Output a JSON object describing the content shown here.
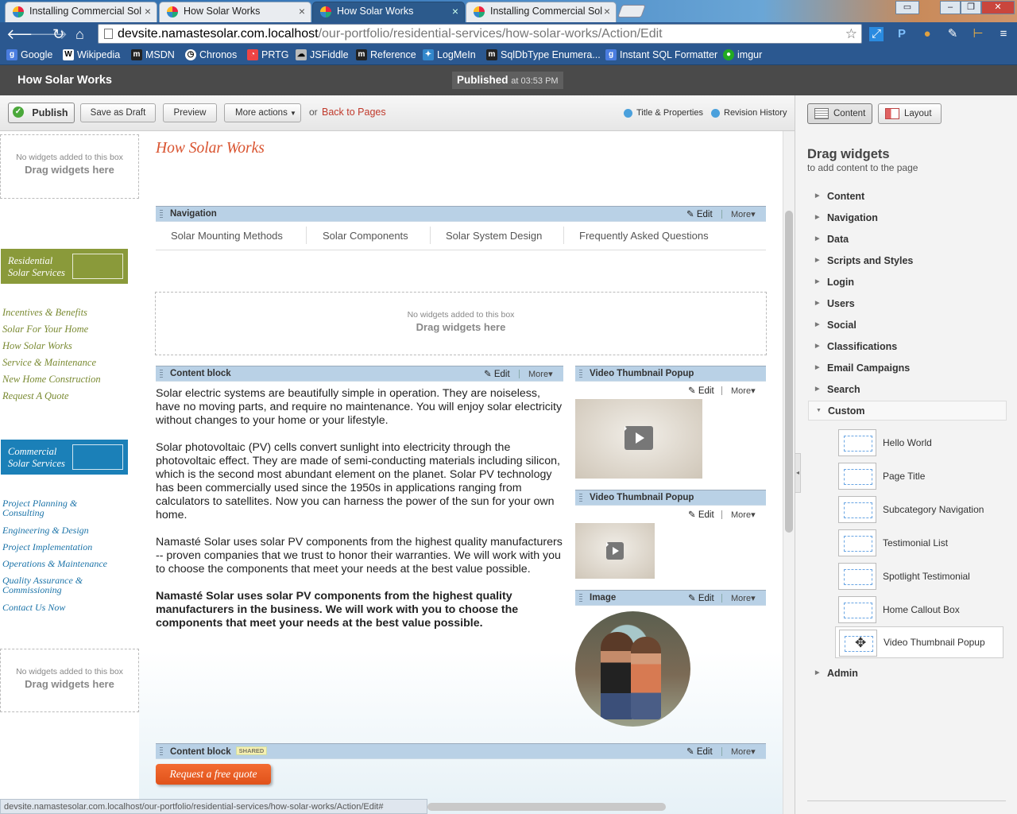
{
  "browser": {
    "tabs": [
      {
        "label": "Installing Commercial Sol"
      },
      {
        "label": "How Solar Works"
      },
      {
        "label": "How Solar Works"
      },
      {
        "label": "Installing Commercial Sol"
      }
    ],
    "url_host": "devsite.namastesolar.com.localhost",
    "url_path": "/our-portfolio/residential-services/how-solar-works/Action/Edit",
    "bookmarks": [
      "Google",
      "Wikipedia",
      "MSDN",
      "Chronos",
      "PRTG",
      "JSFiddle",
      "Reference",
      "LogMeIn",
      "SqlDbType Enumera...",
      "Instant SQL Formatter",
      "imgur"
    ],
    "status_url": "devsite.namastesolar.com.localhost/our-portfolio/residential-services/how-solar-works/Action/Edit#"
  },
  "cms": {
    "page_name": "How Solar Works",
    "published_label": "Published",
    "published_time": "at 03:53 PM"
  },
  "actions": {
    "publish": "Publish",
    "save_draft": "Save as Draft",
    "preview": "Preview",
    "more_actions": "More actions",
    "or": "or",
    "back": "Back to Pages",
    "title_props": "Title & Properties",
    "revision": "Revision History"
  },
  "panel": {
    "content_tab": "Content",
    "layout_tab": "Layout",
    "heading": "Drag widgets",
    "subheading": "to add content to the page",
    "categories": [
      "Content",
      "Navigation",
      "Data",
      "Scripts and Styles",
      "Login",
      "Users",
      "Social",
      "Classifications",
      "Email Campaigns",
      "Search",
      "Custom",
      "Admin"
    ],
    "custom_widgets": [
      "Hello World",
      "Page Title",
      "Subcategory Navigation",
      "Testimonial List",
      "Spotlight Testimonial",
      "Home Callout Box",
      "Video Thumbnail Popup"
    ]
  },
  "dropzone": {
    "small": "No widgets added to this box",
    "big": "Drag widgets here"
  },
  "left": {
    "residential_banner": [
      "Residential",
      "Solar Services"
    ],
    "residential_links": [
      "Incentives & Benefits",
      "Solar For Your Home",
      "How Solar Works",
      "Service & Maintenance",
      "New Home Construction",
      "Request A Quote"
    ],
    "commercial_banner": [
      "Commercial",
      "Solar Services"
    ],
    "commercial_links": [
      "Project Planning & Consulting",
      "Engineering & Design",
      "Project Implementation",
      "Operations & Maintenance",
      "Quality Assurance & Commissioning",
      "Contact Us Now"
    ]
  },
  "main": {
    "heading": "How Solar Works",
    "edit": "Edit",
    "more": "More",
    "shared": "SHARED",
    "widgets": {
      "navigation": "Navigation",
      "content_block": "Content block",
      "video_popup": "Video Thumbnail Popup",
      "image": "Image"
    },
    "nav_items": [
      "Solar Mounting Methods",
      "Solar Components",
      "Solar System Design",
      "Frequently Asked Questions"
    ],
    "paragraphs": [
      "Solar electric systems are beautifully simple in operation. They are noiseless, have no moving parts, and require no maintenance. You will enjoy solar electricity without changes to your home or your lifestyle.",
      "Solar photovoltaic (PV) cells convert sunlight into electricity through the photovoltaic effect. They are made of semi-conducting materials including silicon, which is the second most abundant element on the planet. Solar PV technology has been commercially used since the 1950s in applications ranging from calculators to satellites. Now you can harness the power of the sun for your own home.",
      "Namasté Solar uses solar PV components from the highest quality manufacturers -- proven companies that we trust to honor their warranties. We will work with you to choose the components that meet your needs at the best value possible.",
      "Namasté Solar uses solar PV components from the highest quality manufacturers in the business. We will work with you to choose the components that meet your needs at the best value possible."
    ],
    "quote_button": "Request a free quote"
  }
}
